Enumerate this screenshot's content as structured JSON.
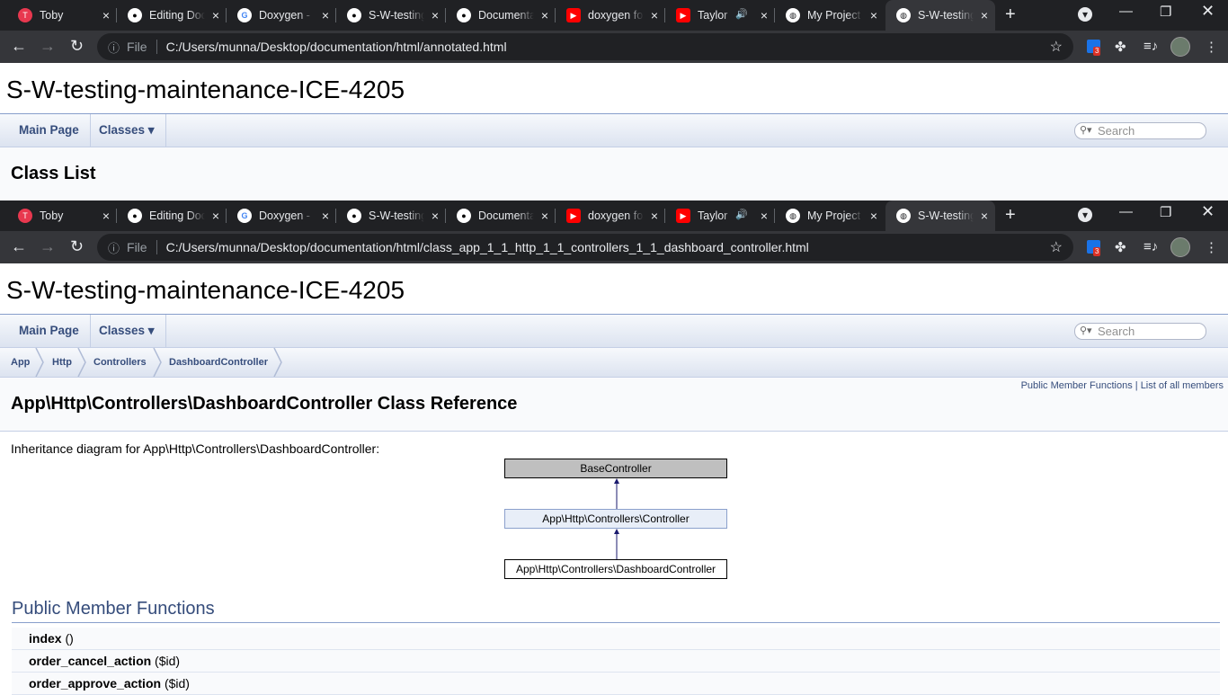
{
  "browser": {
    "tabs": [
      {
        "title": "Toby",
        "favicon": "toby-icon",
        "color": "#e8384f"
      },
      {
        "title": "Editing Doc",
        "favicon": "github-icon",
        "color": "#ffffff"
      },
      {
        "title": "Doxygen -",
        "favicon": "google-icon",
        "color": "#ffffff"
      },
      {
        "title": "S-W-testing",
        "favicon": "github-icon",
        "color": "#ffffff"
      },
      {
        "title": "Documenta",
        "favicon": "github-icon",
        "color": "#ffffff"
      },
      {
        "title": "doxygen fo",
        "favicon": "youtube-icon",
        "color": "#ff0000"
      },
      {
        "title": "Taylor",
        "favicon": "youtube-icon",
        "color": "#ff0000"
      },
      {
        "title": "My Project",
        "favicon": "globe-icon",
        "color": "#ffffff"
      },
      {
        "title": "S-W-testing",
        "favicon": "globe-icon",
        "color": "#ffffff"
      }
    ],
    "close_glyph": "×",
    "new_tab_glyph": "+",
    "file_label": "File",
    "ext_badge_count": "3"
  },
  "top_window": {
    "url": "C:/Users/munna/Desktop/documentation/html/annotated.html",
    "project_title": "S-W-testing-maintenance-ICE-4205",
    "nav": {
      "main_page": "Main Page",
      "classes": "Classes ▾",
      "search_placeholder": "Search"
    },
    "heading": "Class List"
  },
  "bottom_window": {
    "url": "C:/Users/munna/Desktop/documentation/html/class_app_1_1_http_1_1_controllers_1_1_dashboard_controller.html",
    "project_title": "S-W-testing-maintenance-ICE-4205",
    "nav": {
      "main_page": "Main Page",
      "classes": "Classes ▾",
      "search_placeholder": "Search"
    },
    "breadcrumbs": [
      "App",
      "Http",
      "Controllers",
      "DashboardController"
    ],
    "summary": {
      "public_member_functions": "Public Member Functions",
      "sep": " | ",
      "list_all": "List of all members"
    },
    "heading": "App\\Http\\Controllers\\DashboardController Class Reference",
    "inheritance_text": "Inheritance diagram for App\\Http\\Controllers\\DashboardController:",
    "diagram": {
      "nodes": [
        "BaseController",
        "App\\Http\\Controllers\\Controller",
        "App\\Http\\Controllers\\DashboardController"
      ]
    },
    "section_title": "Public Member Functions",
    "members": [
      {
        "name": "index",
        "args": " ()"
      },
      {
        "name": "order_cancel_action",
        "args": " ($id)"
      },
      {
        "name": "order_approve_action",
        "args": " ($id)"
      }
    ]
  }
}
